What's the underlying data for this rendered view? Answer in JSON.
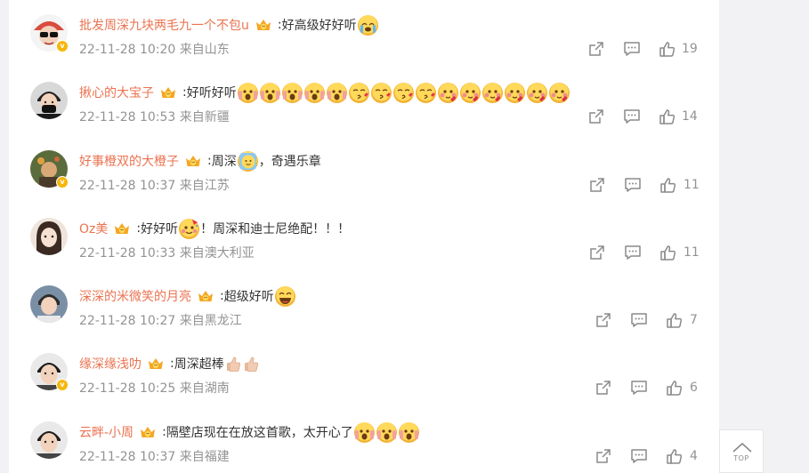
{
  "comments": [
    {
      "username": "批发周深九块两毛九一个不包u",
      "sep": ":",
      "text_parts": [
        "好高级好好听"
      ],
      "emoji_after": [
        "cry"
      ],
      "time": "22-11-28 10:20",
      "location": "来自山东",
      "likes": "19",
      "verified": true,
      "avatar_color": "#d94b3f"
    },
    {
      "username": "揪心的大宝子",
      "sep": ":",
      "text_parts": [
        "好听好听"
      ],
      "emoji_after": [
        "scream",
        "scream",
        "scream",
        "scream",
        "scream",
        "kiss",
        "kiss",
        "kiss",
        "kiss",
        "blush",
        "blush",
        "blush",
        "blush",
        "blush",
        "blush"
      ],
      "time": "22-11-28 10:53",
      "location": "来自新疆",
      "likes": "14",
      "verified": false,
      "avatar_color": "#3a3a3a"
    },
    {
      "username": "好事橙双的大橙子",
      "sep": ":",
      "text_parts": [
        "周深"
      ],
      "emoji_after": [
        "wave"
      ],
      "text_after": "，奇遇乐章",
      "time": "22-11-28 10:37",
      "location": "来自江苏",
      "likes": "11",
      "verified": true,
      "avatar_color": "#5a6b3c"
    },
    {
      "username": "Oz美",
      "sep": ":",
      "text_parts": [
        "好好听"
      ],
      "emoji_after": [
        "party"
      ],
      "text_after": "！周深和迪士尼绝配！！！",
      "time": "22-11-28 10:33",
      "location": "来自澳大利亚",
      "likes": "11",
      "verified": false,
      "avatar_color": "#e8d6cc"
    },
    {
      "username": "深深的米微笑的月亮",
      "sep": ":",
      "text_parts": [
        "超级好听"
      ],
      "emoji_after": [
        "laugh"
      ],
      "time": "22-11-28 10:27",
      "location": "来自黑龙江",
      "likes": "7",
      "verified": false,
      "avatar_color": "#7a8fa6"
    },
    {
      "username": "缘深缘浅叻",
      "sep": ":",
      "text_parts": [
        "周深超棒"
      ],
      "emoji_after": [
        "thumb",
        "thumb"
      ],
      "time": "22-11-28 10:25",
      "location": "来自湖南",
      "likes": "6",
      "verified": true,
      "avatar_color": "#2b2b2b"
    },
    {
      "username": "云畔-小周",
      "sep": ":",
      "text_parts": [
        "隔壁店现在在放这首歌，太开心了"
      ],
      "emoji_after": [
        "scream",
        "scream",
        "scream"
      ],
      "time": "22-11-28 10:37",
      "location": "来自福建",
      "likes": "4",
      "verified": false,
      "avatar_color": "#3c3c3c"
    }
  ],
  "icons": {
    "share": "share-icon",
    "comment": "comment-icon",
    "like": "like-icon",
    "badge": "fan-badge-icon",
    "verified": "verified-icon",
    "to_top": "arrow-up-icon"
  },
  "back_to_top_label": "TOP",
  "colors": {
    "username": "#eb7350",
    "meta": "#939393",
    "icon": "#8a8a8a",
    "background": "#f2f2f5"
  }
}
